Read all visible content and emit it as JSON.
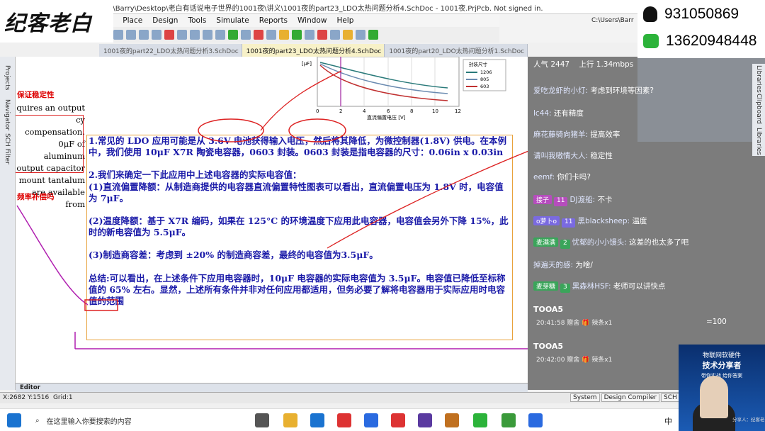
{
  "window": {
    "title": "rs\\Barry\\Desktop\\老白有话说电子世界的1001夜\\讲义\\1001夜的part23_LDO太热问题分析4.SchDoc - 1001夜.PrjPcb. Not signed in.",
    "path_right": "C:\\Users\\Barr"
  },
  "logo": {
    "text": "纪客老白"
  },
  "menu": [
    "ject",
    "Place",
    "Design",
    "Tools",
    "Simulate",
    "Reports",
    "Window",
    "Help"
  ],
  "tabs": [
    {
      "label": "1001夜的part22_LDO太热问题分析3.SchDoc",
      "active": false
    },
    {
      "label": "1001夜的part23_LDO太热问题分析4.SchDoc",
      "active": true
    },
    {
      "label": "1001夜的part20_LDO太热问题分析1.SchDoc",
      "active": false
    }
  ],
  "contact": {
    "qq": "931050869",
    "wechat": "13620948448"
  },
  "left_panels": [
    "Projects",
    "Navigator",
    "SCH Filter"
  ],
  "right_panels": [
    "Libraries",
    "Clipboard",
    "Libraries"
  ],
  "sheet": {
    "english_lines": [
      "quires an output",
      "cy compensation.",
      "0μF of aluminum",
      "output capacitor",
      "mount tantalum",
      "are available from"
    ],
    "red_fragment_1": "保证稳定性",
    "red_fragment_2": "频率补偿吗",
    "mini_chart": {
      "xlabel": "直流偏置电压 [V]",
      "ticks": [
        "0",
        "2",
        "4",
        "6",
        "8",
        "10",
        "12"
      ],
      "legend_title": "封装尺寸",
      "legend": [
        "1206",
        "805",
        "603"
      ],
      "ylabel": "[μF]"
    },
    "paragraphs": [
      "1.常见的 LDO 应用可能是从 3.6V 电池获得输入电压，然后将其降低，为微控制器(1.8V) 供电。在本例中，我们使用 10μF X7R 陶瓷电容器，0603 封装。0603 封装是指电容器的尺寸：0.06in x 0.03in",
      "2.我们来确定一下此应用中上述电容器的实际电容值：",
      "(1)直流偏置降额：从制造商提供的电容器直流偏置特性图表可以看出，直流偏置电压为 1.8V 时，电容值为 7μF。",
      "(2)温度降额：基于 X7R 编码，如果在 125°C 的环境温度下应用此电容器，电容值会另外下降 15%，此时的新电容值为 5.5μF。",
      "(3)制造商容差：考虑到 ±20% 的制造商容差，最终的电容值为3.5μF。",
      "总结:可以看出，在上述条件下应用电容器时，10μF 电容器的实际电容值为 3.5μF。电容值已降低至标称值的 65% 左右。显然，上述所有条件并非对任何应用都适用，但务必要了解将电容器用于实际应用时电容值的范围"
    ]
  },
  "editor_tab": "Editor",
  "chat": {
    "header": {
      "people": "人气 2447",
      "upload": "上行 1.34mbps"
    },
    "messages": [
      {
        "user": "爱吃龙虾的小灯:",
        "text": "考虑到环境等因素?",
        "badge": "",
        "level": ""
      },
      {
        "user": "lc44:",
        "text": "还有精度",
        "badge": "",
        "level": ""
      },
      {
        "user": "麻花藤骑向猪羊:",
        "text": "提高效率",
        "badge": "",
        "level": ""
      },
      {
        "user": "请叫我嗷情大人:",
        "text": "稳定性",
        "badge": "",
        "level": ""
      },
      {
        "user": "eemf:",
        "text": "你们卡吗?",
        "badge": "",
        "level": ""
      },
      {
        "user": "DJ渡船:",
        "text": "不卡",
        "badge": "接子",
        "level": "11"
      },
      {
        "user": "黑blacksheep:",
        "text": "温度",
        "badge": "o萝卜o",
        "level": "11"
      },
      {
        "user": "忧郁的小小馒头:",
        "text": "这差的也太多了吧",
        "badge": "麦满满",
        "level": "2"
      },
      {
        "user": "掉遍天的感:",
        "text": "为啥/",
        "badge": "",
        "level": ""
      },
      {
        "user": "黑森林HSF:",
        "text": "老师可以讲快点",
        "badge": "麦芽糖",
        "level": "3"
      }
    ],
    "gifts": [
      {
        "name": "TOOA5",
        "time": "20:41:58 赠舍",
        "gift": "辣条x1"
      },
      {
        "name": "TOOA5",
        "time": "20:42:00 赠舍",
        "gift": "辣条x1"
      }
    ],
    "counter": "=100"
  },
  "status": {
    "coords": "X:2682 Y:1516",
    "grid": "Grid:1",
    "buttons": [
      "System",
      "Design Compiler",
      "SCH"
    ]
  },
  "taskbar": {
    "search_placeholder": "在这里输入你要搜索的内容",
    "ime": "中"
  },
  "speaker": {
    "line1": "物联网软硬件",
    "line2": "技术分享者",
    "line3": "带你实战 给你答案",
    "line4": "分享人：纪客老白"
  }
}
